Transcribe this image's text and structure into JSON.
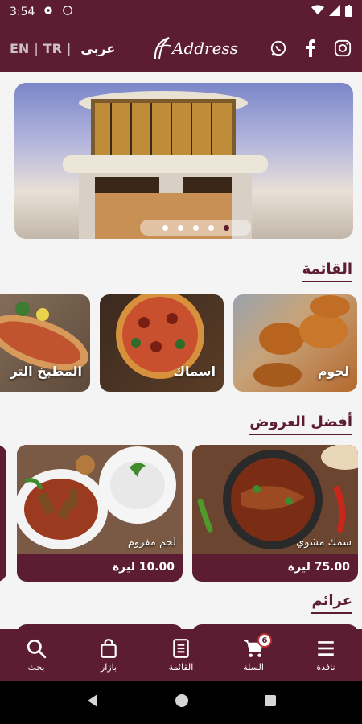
{
  "status_bar": {
    "time": "3:54"
  },
  "header": {
    "languages": [
      "EN",
      "TR",
      "عربي"
    ],
    "logo_text": "Address",
    "social": [
      "whatsapp-icon",
      "facebook-icon",
      "instagram-icon"
    ]
  },
  "banner": {
    "dots": 5,
    "active_dot": 4
  },
  "sections": {
    "menu_title": "القائمة",
    "offers_title": "أفضل العروض",
    "parties_title": "عزائم"
  },
  "categories": [
    {
      "label": "لحوم"
    },
    {
      "label": "اسماك"
    },
    {
      "label": "المطبخ التر"
    }
  ],
  "offers": [
    {
      "name": "سمك مشوي",
      "price": "75.00 ليرة"
    },
    {
      "name": "لحم مفروم",
      "price": "10.00 ليرة"
    }
  ],
  "bottom_nav": [
    {
      "label": "نافذة",
      "icon": "menu-icon"
    },
    {
      "label": "السلة",
      "icon": "cart-icon",
      "badge": "6"
    },
    {
      "label": "القائمة",
      "icon": "menu-book-icon"
    },
    {
      "label": "بازار",
      "icon": "shopping-bag-icon"
    },
    {
      "label": "بحث",
      "icon": "search-icon"
    }
  ],
  "colors": {
    "primary": "#5c1d32",
    "background": "#f4f4f4"
  }
}
